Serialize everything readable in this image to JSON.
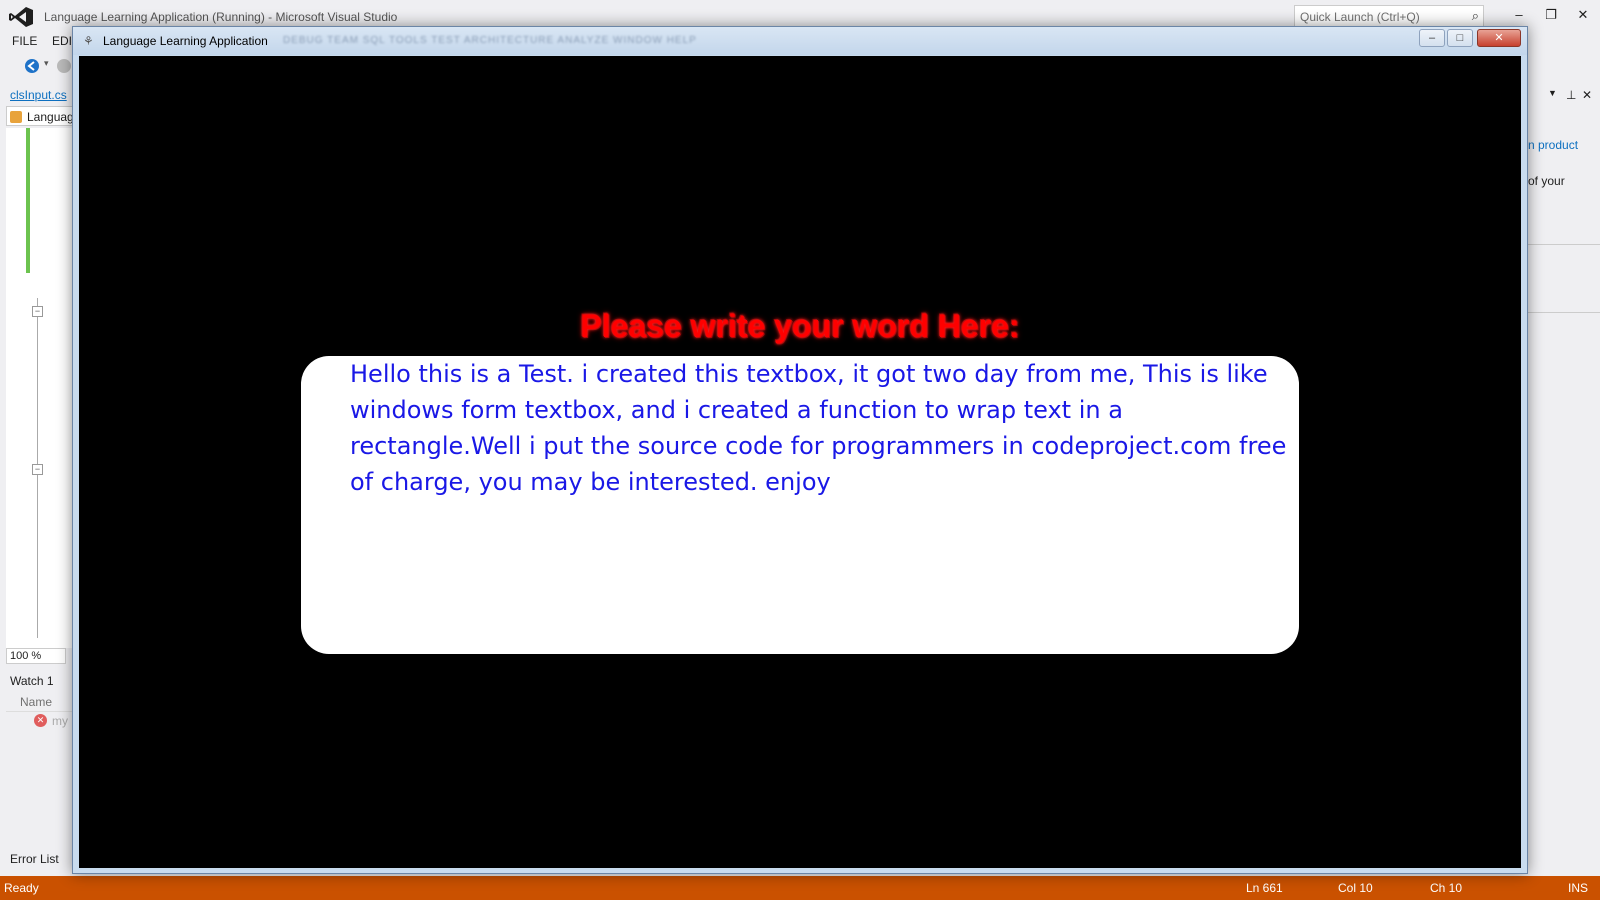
{
  "vs": {
    "window_title": "Language Learning Application (Running) - Microsoft Visual Studio",
    "quick_launch_placeholder": "Quick Launch (Ctrl+Q)",
    "menu": [
      "FILE",
      "EDI"
    ],
    "doc_tab": "clsInput.cs",
    "nav_label": "Languag",
    "zoom": "100 %",
    "watch_title": "Watch 1",
    "watch_col_name": "Name",
    "watch_row_name": "my",
    "bottom_tab": "Error List",
    "right_link": "n product",
    "right_text": "of your",
    "status": {
      "left": "Ready",
      "ln": "Ln 661",
      "col": "Col 10",
      "ch": "Ch 10",
      "mode": "INS"
    },
    "colors": {
      "statusbar": "#ca5100",
      "accent": "#68217a"
    }
  },
  "app": {
    "title": "Language Learning Application",
    "ghost_menu": "DEBUG    TEAM    SQL    TOOLS    TEST    ARCHITECTURE    ANALYZE    WINDOW    HELP",
    "prompt": "Please write your word Here:",
    "textbox_text": "Hello this is a Test. i created this textbox, it got two day from me, This is like windows form textbox, and i created a function to wrap text in a rectangle.Well i put the source code for programmers in codeproject.com free of charge, you may be interested. enjoy",
    "colors": {
      "prompt": "#ff0000",
      "text": "#1a18e6",
      "background": "#000000"
    }
  }
}
